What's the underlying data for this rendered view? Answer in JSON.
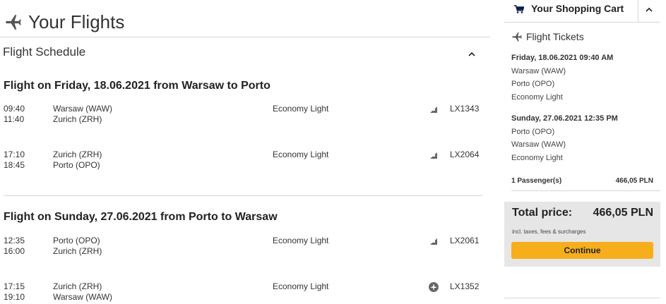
{
  "header": {
    "title": "Your Flights",
    "icon": "plane-icon"
  },
  "schedule": {
    "heading": "Flight Schedule"
  },
  "flights": [
    {
      "heading": "Flight on Friday, 18.06.2021 from Warsaw to Porto",
      "segments": [
        {
          "dep_time": "09:40",
          "arr_time": "11:40",
          "dep_city": "Warsaw (WAW)",
          "arr_city": "Zurich (ZRH)",
          "cabin": "Economy Light",
          "airline_icon": "swiss-logo-icon",
          "flight_no": "LX1343"
        },
        {
          "dep_time": "17:10",
          "arr_time": "18:45",
          "dep_city": "Zurich (ZRH)",
          "arr_city": "Porto (OPO)",
          "cabin": "Economy Light",
          "airline_icon": "swiss-logo-icon",
          "flight_no": "LX2064"
        }
      ]
    },
    {
      "heading": "Flight on Sunday, 27.06.2021 from Porto to Warsaw",
      "segments": [
        {
          "dep_time": "12:35",
          "arr_time": "16:00",
          "dep_city": "Porto (OPO)",
          "arr_city": "Zurich (ZRH)",
          "cabin": "Economy Light",
          "airline_icon": "swiss-logo-icon",
          "flight_no": "LX2061"
        },
        {
          "dep_time": "17:15",
          "arr_time": "19:10",
          "dep_city": "Zurich (ZRH)",
          "arr_city": "Warsaw (WAW)",
          "cabin": "Economy Light",
          "airline_icon": "airline-circle-icon",
          "flight_no": "LX1352"
        }
      ]
    }
  ],
  "cart": {
    "title": "Your Shopping Cart",
    "tickets_heading": "Flight Tickets",
    "outbound": {
      "datetime": "Friday, 18.06.2021 09:40 AM",
      "from": "Warsaw (WAW)",
      "to": "Porto (OPO)",
      "cabin": "Economy Light"
    },
    "inbound": {
      "datetime": "Sunday, 27.06.2021 12:35 PM",
      "from": "Porto (OPO)",
      "to": "Warsaw (WAW)",
      "cabin": "Economy Light"
    },
    "passengers_label": "1 Passenger(s)",
    "passengers_price": "466,05 PLN",
    "total_label": "Total price:",
    "total_amount": "466,05 PLN",
    "total_note": "incl. taxes, fees & surcharges",
    "continue_label": "Continue"
  },
  "colors": {
    "accent": "#f7ae1c",
    "total_bg": "#e6e6e6",
    "divider": "#d6d6d6",
    "cart_icon": "#0b1e4c"
  }
}
